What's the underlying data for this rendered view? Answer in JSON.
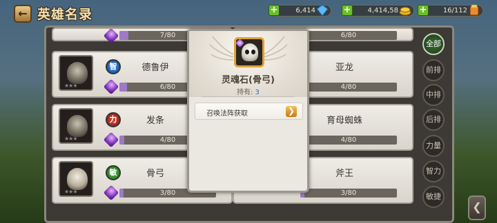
{
  "header": {
    "back_label": "←",
    "title": "英雄名录",
    "resources": [
      {
        "value": "6,414",
        "icon": "diamond-icon"
      },
      {
        "value": "4,414,58",
        "icon": "gold-coins-icon"
      },
      {
        "value": "16/112",
        "icon": "stamina-icon"
      }
    ]
  },
  "hero_cards": [
    {
      "side": "left",
      "name": "",
      "progress": "7/80",
      "stars": "★★★",
      "attr": "",
      "partial": true
    },
    {
      "side": "right",
      "name": "",
      "progress": "6/80",
      "partial": true
    },
    {
      "side": "left",
      "name": "德鲁伊",
      "attr": "智",
      "attr_type": "zhi",
      "progress": "6/80",
      "stars": "★★★"
    },
    {
      "side": "right",
      "name": "亚龙",
      "progress": "4/80"
    },
    {
      "side": "left",
      "name": "发条",
      "attr": "力",
      "attr_type": "li",
      "progress": "4/80",
      "stars": "★★★"
    },
    {
      "side": "right",
      "name": "育母蜘蛛",
      "progress": "4/80"
    },
    {
      "side": "left",
      "name": "骨弓",
      "attr": "敏",
      "attr_type": "min",
      "progress": "3/80",
      "stars": "★★★"
    },
    {
      "side": "right",
      "name": "斧王",
      "progress": "3/80"
    }
  ],
  "filters": [
    "全部",
    "前排",
    "中排",
    "后排",
    "力量",
    "智力",
    "敏捷"
  ],
  "side_arrow": "❮",
  "popup": {
    "item_name": "灵魂石(骨弓)",
    "owned_label": "持有:",
    "owned_count": "3",
    "source_label": "召唤法阵获取",
    "source_arrow": "❯"
  },
  "colors": {
    "accent_gold": "#e0a13a",
    "soul_purple": "#7b2fb6",
    "owned_blue": "#2c6fbf"
  }
}
